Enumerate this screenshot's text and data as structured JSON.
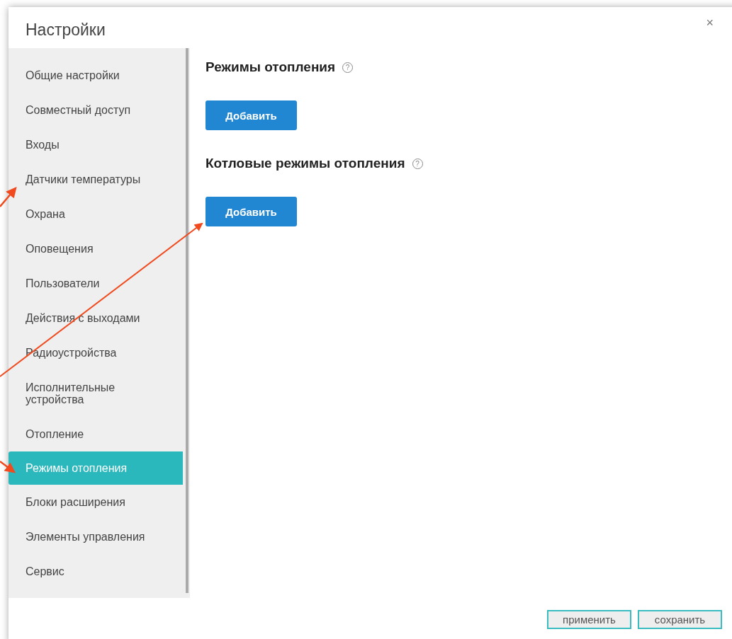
{
  "window": {
    "title": "Настройки",
    "close": "×"
  },
  "sidebar": {
    "items": [
      {
        "label": "Общие настройки",
        "selected": false
      },
      {
        "label": "Совместный доступ",
        "selected": false
      },
      {
        "label": "Входы",
        "selected": false
      },
      {
        "label": "Датчики температуры",
        "selected": false
      },
      {
        "label": "Охрана",
        "selected": false
      },
      {
        "label": "Оповещения",
        "selected": false
      },
      {
        "label": "Пользователи",
        "selected": false
      },
      {
        "label": "Действия с выходами",
        "selected": false
      },
      {
        "label": "Радиоустройства",
        "selected": false
      },
      {
        "label": "Исполнительные устройства",
        "selected": false
      },
      {
        "label": "Отопление",
        "selected": false
      },
      {
        "label": "Режимы отопления",
        "selected": true
      },
      {
        "label": "Блоки расширения",
        "selected": false
      },
      {
        "label": "Элементы управления",
        "selected": false
      },
      {
        "label": "Сервис",
        "selected": false
      }
    ]
  },
  "sections": [
    {
      "title": "Режимы отопления",
      "help": "?",
      "button": "Добавить"
    },
    {
      "title": "Котловые режимы отопления",
      "help": "?",
      "button": "Добавить"
    }
  ],
  "footer": {
    "buttons": [
      "применить",
      "сохранить"
    ]
  }
}
